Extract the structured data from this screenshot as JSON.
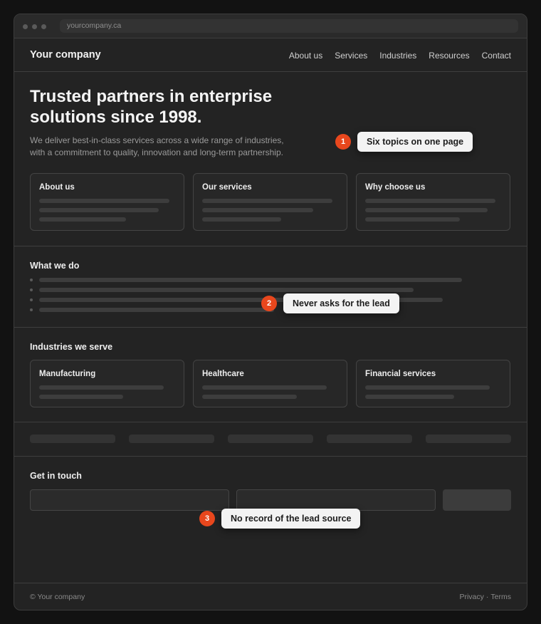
{
  "browser": {
    "url": "yourcompany.ca"
  },
  "nav": {
    "brand": "Your company",
    "links": [
      "About us",
      "Services",
      "Industries",
      "Resources",
      "Contact"
    ]
  },
  "hero": {
    "title": "Trusted partners in enterprise solutions since 1998.",
    "subtitle": "We deliver best-in-class services across a wide range of industries, with a commitment to quality, innovation and long-term partnership.",
    "cards": [
      {
        "title": "About us"
      },
      {
        "title": "Our services"
      },
      {
        "title": "Why choose us"
      }
    ]
  },
  "what_we_do": {
    "title": "What we do"
  },
  "industries": {
    "title": "Industries we serve",
    "cards": [
      {
        "title": "Manufacturing"
      },
      {
        "title": "Healthcare"
      },
      {
        "title": "Financial services"
      }
    ]
  },
  "contact": {
    "title": "Get in touch"
  },
  "footer": {
    "copyright": "© Your company",
    "privacy": "Privacy",
    "separator": "·",
    "terms": "Terms"
  },
  "callouts": [
    {
      "number": "1",
      "text": "Six topics on one page"
    },
    {
      "number": "2",
      "text": "Never asks for the lead"
    },
    {
      "number": "3",
      "text": "No record of the lead source"
    }
  ],
  "colors": {
    "background": "#121212",
    "surface": "#232323",
    "accent": "#e8471d",
    "callout": "#f3f3f3"
  }
}
